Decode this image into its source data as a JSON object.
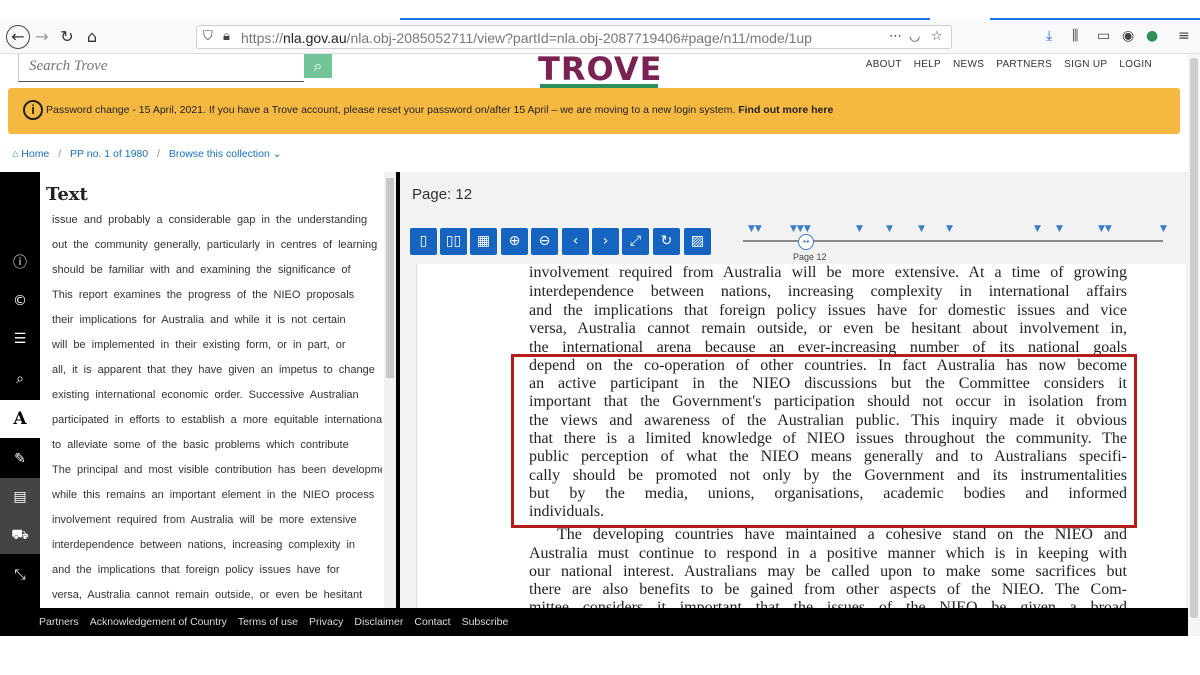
{
  "browser": {
    "url_prefix": "https://",
    "url_domain": "nla.gov.au",
    "url_path": "/nla.obj-2085052711/view?partId=nla.obj-2087719406#page/n11/mode/1up"
  },
  "header": {
    "search_placeholder": "Search Trove",
    "logo": "TROVE",
    "nav": [
      "ABOUT",
      "HELP",
      "NEWS",
      "PARTNERS",
      "SIGN UP",
      "LOGIN"
    ]
  },
  "banner": {
    "text": "Password change - 15 April, 2021. If you have a Trove account, please reset your password on/after 15 April – we are moving to a new login system.",
    "link": "Find out more here"
  },
  "breadcrumb": {
    "home": "Home",
    "item": "PP no. 1 of 1980",
    "browse": "Browse this collection"
  },
  "text_panel": {
    "title": "Text",
    "lines": [
      "issue and probably a considerable gap in the understanding",
      "out the community generally, particularly in centres of learning",
      "should be familiar with and examining the significance of",
      "This report examines the progress of the NIEO proposals",
      "their implications for Australia and while it is not certain",
      "will be implemented in their existing form, or in part, or",
      "all, it is apparent that they have given an impetus to change",
      "existing international economic order. Successive Australian",
      "participated in efforts to establish a more equitable international",
      "to alleviate some of the basic problems which contribute",
      "The principal and most visible contribution has been development",
      "while this remains an important element in the NIEO process",
      "involvement required from Australia will be more extensive",
      "interdependence between nations, increasing complexity in",
      "and the implications that foreign policy issues have for",
      "versa, Australia cannot remain outside, or even be hesitant"
    ]
  },
  "viewer": {
    "page_label": "Page: 12",
    "timeline_label": "Page 12",
    "page_lines": [
      "involvement required from Australia will be more extensive. At a time of growing",
      "interdependence between nations, increasing complexity in international affairs",
      "and the implications that foreign policy issues have for domestic issues and vice",
      "versa, Australia cannot remain outside, or even be hesitant about involvement in,",
      "the international arena because an ever-increasing number of its national goals",
      "depend on the co-operation of other countries. In fact Australia has now become",
      "an active participant in the NIEO discussions but the Committee considers it",
      "important that the Government's participation should not occur in isolation from",
      "the views and awareness of the Australian public. This inquiry made it obvious",
      "that there is a limited knowledge of NIEO issues throughout the community. The",
      "public perception of what the NIEO means generally and to Australians specifi-",
      "cally should be promoted not only by the Government and its instrumentalities",
      "but by the media, unions, organisations, academic bodies and informed",
      "individuals.",
      "The developing countries have maintained a cohesive stand on the NIEO and",
      "Australia must continue to respond in a positive manner which is in keeping with",
      "our national interest. Australians may be called upon to make some sacrifices but",
      "there are also benefits to be gained from other aspects of the NIEO. The Com-",
      "mittee considers it important that the issues of the NIEO be given a broad"
    ]
  },
  "footer": [
    "Partners",
    "Acknowledgement of Country",
    "Terms of use",
    "Privacy",
    "Disclaimer",
    "Contact",
    "Subscribe"
  ],
  "colors": {
    "banner": "#f5b942",
    "accent_blue": "#1565c0",
    "highlight_red": "#b71c1c",
    "logo_purple": "#7a2252",
    "logo_green": "#2e8f5a"
  }
}
